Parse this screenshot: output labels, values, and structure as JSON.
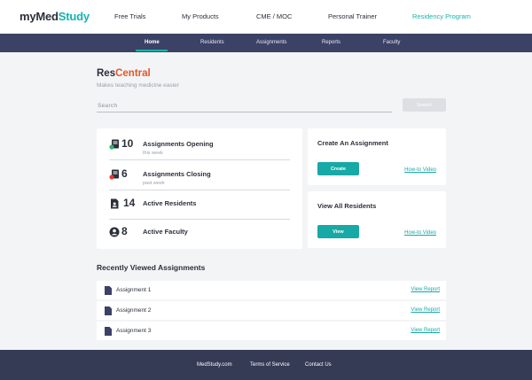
{
  "header": {
    "logo_main": "myMed",
    "logo_accent": "Study",
    "nav": [
      "Free Trials",
      "My Products",
      "CME / MOC",
      "Personal Trainer",
      "Residency Program"
    ],
    "active_nav": "Residency Program"
  },
  "subnav": {
    "items": [
      "Home",
      "Residents",
      "Assignments",
      "Reports",
      "Faculty"
    ],
    "active": "Home"
  },
  "brand": {
    "name_main": "Res",
    "name_accent": "Central",
    "tagline": "Makes teaching medicine easier"
  },
  "search": {
    "placeholder": "Search",
    "button_label": "Search"
  },
  "stats": [
    {
      "count": "10",
      "label": "Assignments Opening",
      "sub": "this week",
      "icon": "assignment-open-icon"
    },
    {
      "count": "6",
      "label": "Assignments Closing",
      "sub": "past week",
      "icon": "assignment-close-icon"
    },
    {
      "count": "14",
      "label": "Active Residents",
      "sub": "",
      "icon": "resident-badge-icon"
    },
    {
      "count": "8",
      "label": "Active Faculty",
      "sub": "",
      "icon": "faculty-user-icon"
    }
  ],
  "actions": [
    {
      "title": "Create An Assignment",
      "button": "Create",
      "link": "How-to Video"
    },
    {
      "title": "View All Residents",
      "button": "View",
      "link": "How-to Video"
    }
  ],
  "recent": {
    "title": "Recently Viewed Assignments",
    "link_label": "View Report",
    "items": [
      "Assignment 1",
      "Assignment 2",
      "Assignment 3"
    ]
  },
  "footer": {
    "links": [
      "MedStudy.com",
      "Terms of Service",
      "Contact Us"
    ]
  },
  "colors": {
    "accent": "#17b3ad",
    "brand_orange": "#e8542a",
    "nav_bar": "#3b4266",
    "footer": "#353a55",
    "background": "#f3f4f6"
  }
}
